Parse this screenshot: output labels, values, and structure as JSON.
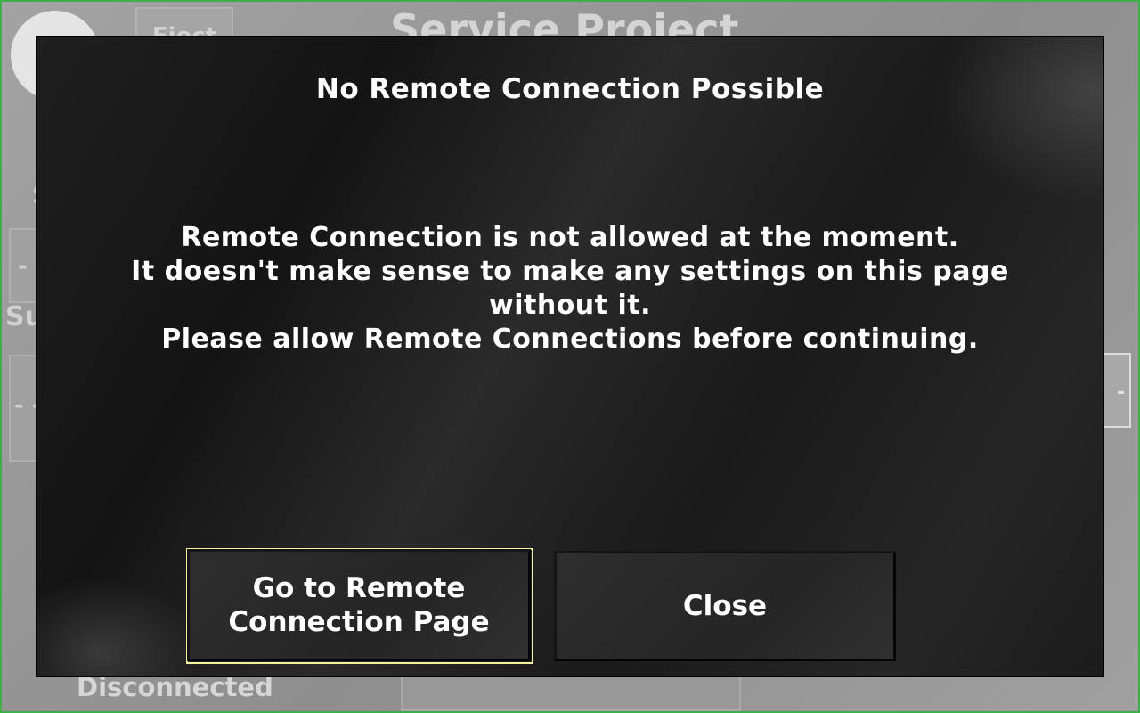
{
  "background": {
    "header": {
      "title": "Service Project",
      "eject_label": "Eject",
      "logo_icon": "disc-logo-icon"
    },
    "left_panel": {
      "letter": "S",
      "box1_text": "-",
      "label": "Su",
      "box2_text": "- -"
    },
    "right_panel": {
      "box_text": "-"
    },
    "status_text": "Disconnected"
  },
  "dialog": {
    "title": "No Remote Connection Possible",
    "message_lines": [
      "Remote Connection is not allowed at the moment.",
      "It doesn't make sense to make any settings on this page",
      "without it.",
      "Please allow Remote Connections before continuing."
    ],
    "buttons": {
      "goto_remote_line1": "Go to Remote",
      "goto_remote_line2": "Connection Page",
      "close": "Close"
    }
  },
  "colors": {
    "frame_border": "#3fae4a",
    "focus_ring": "#f0f0a0",
    "dialog_text": "#ffffff"
  }
}
